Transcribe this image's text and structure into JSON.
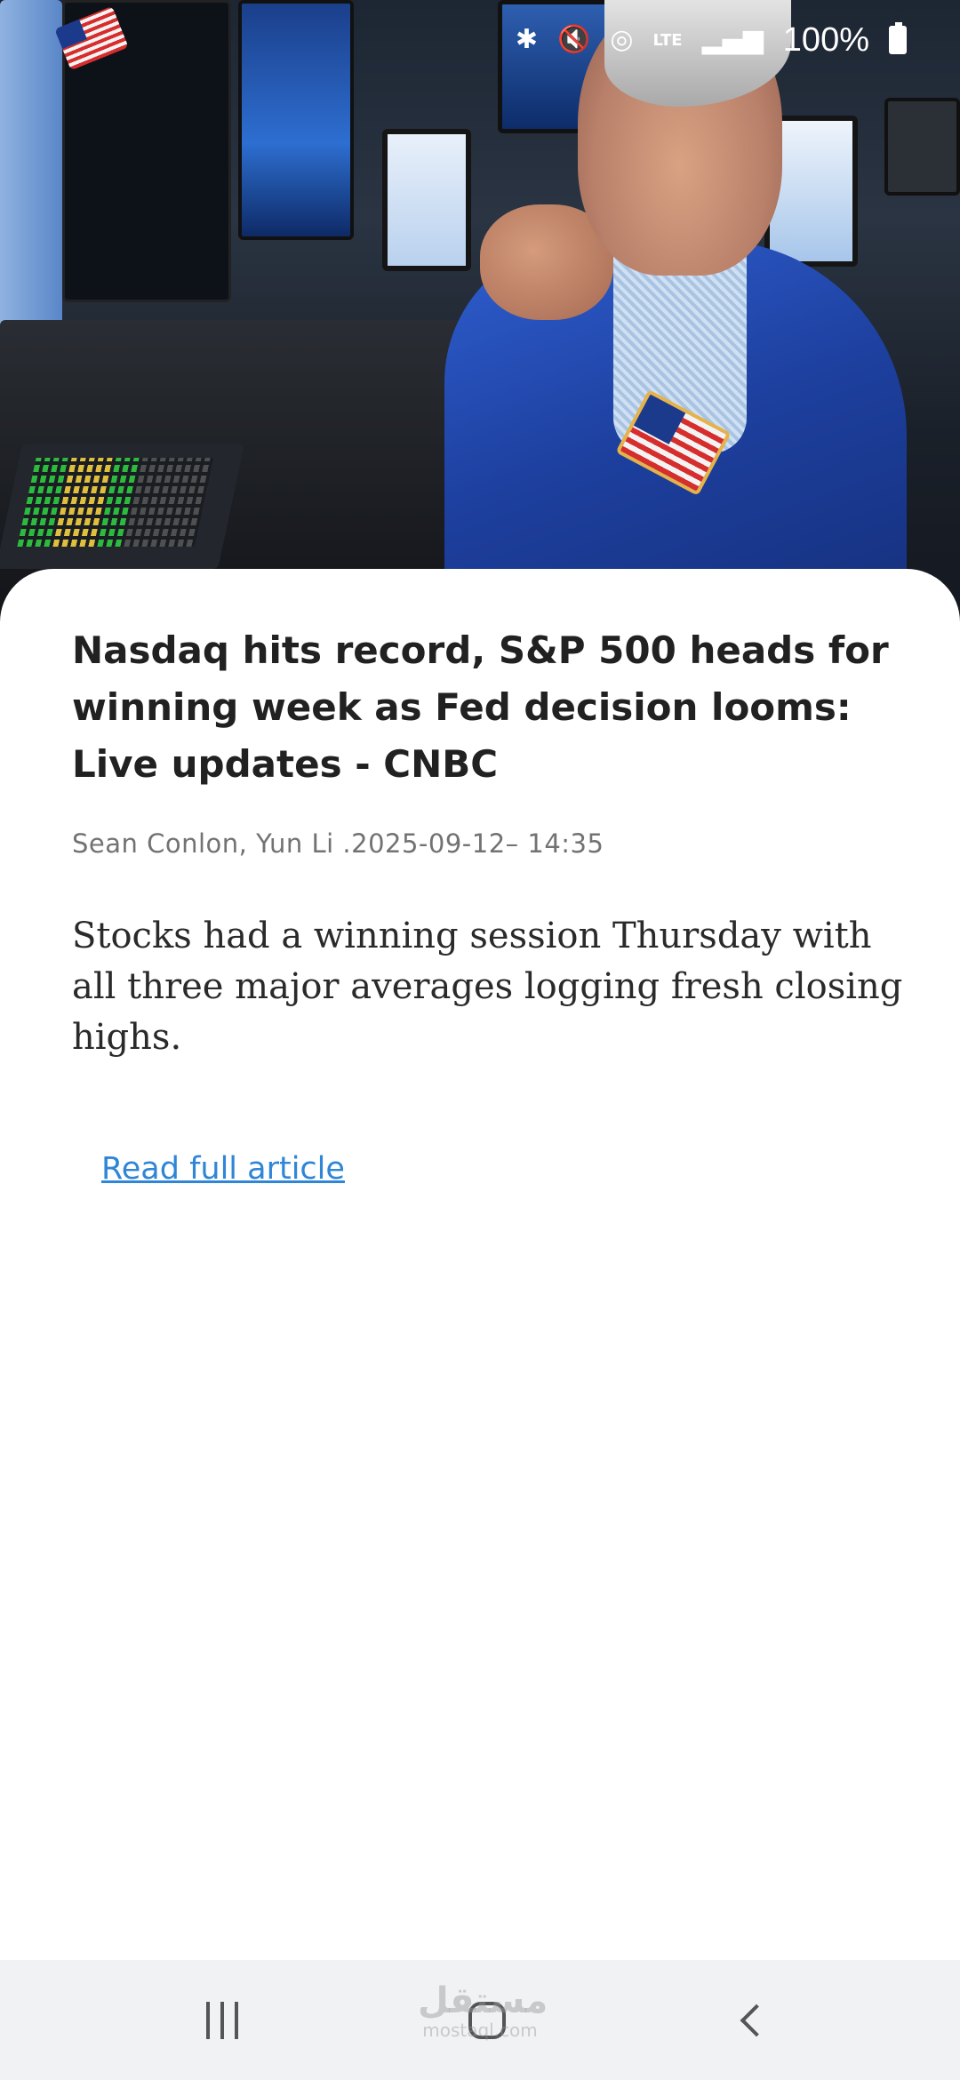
{
  "status_bar": {
    "icons": [
      "bluetooth-icon",
      "mute-icon",
      "hotspot-icon",
      "lte-icon",
      "signal-icon",
      "battery-icon"
    ],
    "network": "LTE",
    "battery_percent": "100%"
  },
  "article": {
    "headline": "Nasdaq hits record, S&P 500 heads for winning week as Fed decision looms: Live updates - CNBC",
    "meta": "Sean Conlon, Yun Li .2025-09-12– 14:35",
    "summary": "Stocks had a winning session Thursday with all three major averages logging fresh closing highs.",
    "read_more_label": "Read full article"
  },
  "watermark": {
    "arabic": "مستقل",
    "latin": "mostaql.com"
  },
  "nav_bar": {
    "buttons": [
      "recents-icon",
      "home-icon",
      "back-icon"
    ]
  },
  "colors": {
    "link": "#2f86d6",
    "headline": "#212121",
    "meta": "#727272",
    "nav_bg": "#f1f2f4"
  }
}
